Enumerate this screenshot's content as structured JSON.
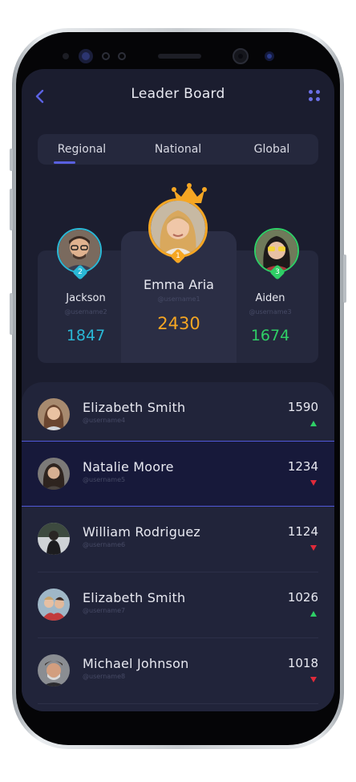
{
  "header": {
    "title": "Leader Board",
    "back_icon": "chevron-left-icon",
    "menu_icon": "grid-dots-icon"
  },
  "tabs": [
    {
      "label": "Regional",
      "active": true
    },
    {
      "label": "National",
      "active": false
    },
    {
      "label": "Global",
      "active": false
    }
  ],
  "podium": {
    "first": {
      "rank": "1",
      "name": "Emma Aria",
      "username": "@username1",
      "score": "2430",
      "color": "#f5a623"
    },
    "second": {
      "rank": "2",
      "name": "Jackson",
      "username": "@username2",
      "score": "1847",
      "color": "#2ab8d6"
    },
    "third": {
      "rank": "3",
      "name": "Aiden",
      "username": "@username3",
      "score": "1674",
      "color": "#2fcf66"
    }
  },
  "list": [
    {
      "name": "Elizabeth Smith",
      "username": "@username4",
      "score": "1590",
      "trend": "up"
    },
    {
      "name": "Natalie Moore",
      "username": "@username5",
      "score": "1234",
      "trend": "down"
    },
    {
      "name": "William Rodriguez",
      "username": "@username6",
      "score": "1124",
      "trend": "down"
    },
    {
      "name": "Elizabeth Smith",
      "username": "@username7",
      "score": "1026",
      "trend": "up"
    },
    {
      "name": "Michael Johnson",
      "username": "@username8",
      "score": "1018",
      "trend": "down"
    }
  ]
}
